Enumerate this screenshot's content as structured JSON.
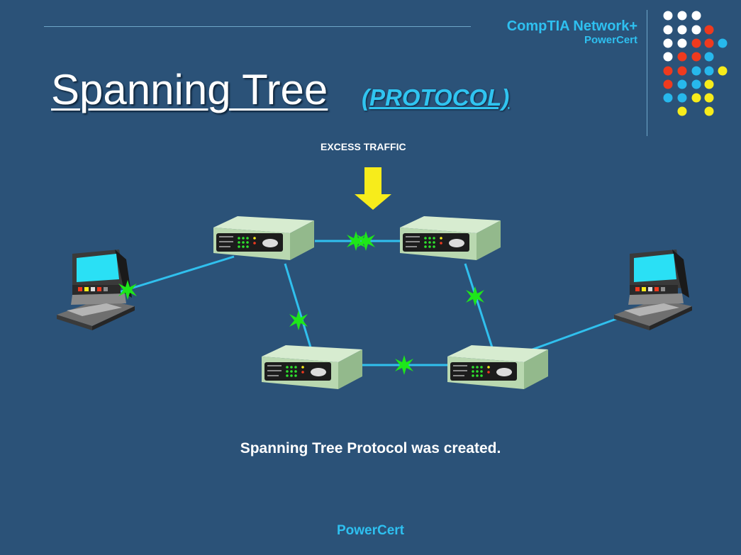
{
  "branding": {
    "line1": "CompTIA Network+",
    "line2": "PowerCert",
    "footer": "PowerCert",
    "dot_colors": {
      "white": "#ffffff",
      "red": "#ef3a1e",
      "cyan": "#27b8ec",
      "yellow": "#f7ec1b"
    }
  },
  "slide": {
    "title": "Spanning Tree",
    "subtitle": "(PROTOCOL)",
    "arrow_label": "EXCESS TRAFFIC",
    "caption": "Spanning Tree Protocol was created."
  },
  "diagram": {
    "nodes": [
      {
        "id": "computer-left",
        "kind": "computer"
      },
      {
        "id": "switch-top-left",
        "kind": "switch"
      },
      {
        "id": "switch-top-right",
        "kind": "switch"
      },
      {
        "id": "switch-bottom-left",
        "kind": "switch"
      },
      {
        "id": "switch-bottom-right",
        "kind": "switch"
      },
      {
        "id": "computer-right",
        "kind": "computer"
      }
    ],
    "links": [
      {
        "from": "computer-left",
        "to": "switch-top-left",
        "excess_traffic": true
      },
      {
        "from": "switch-top-left",
        "to": "switch-top-right",
        "excess_traffic": true
      },
      {
        "from": "switch-top-left",
        "to": "switch-bottom-left",
        "excess_traffic": true
      },
      {
        "from": "switch-top-right",
        "to": "switch-bottom-right",
        "excess_traffic": true
      },
      {
        "from": "switch-bottom-left",
        "to": "switch-bottom-right",
        "excess_traffic": true
      },
      {
        "from": "switch-bottom-right",
        "to": "computer-right",
        "excess_traffic": false
      }
    ],
    "colors": {
      "link": "#30c0ee",
      "collision": "#1ee61a",
      "arrow": "#f7ec1b",
      "switch_body": "#b9d8b0"
    }
  }
}
